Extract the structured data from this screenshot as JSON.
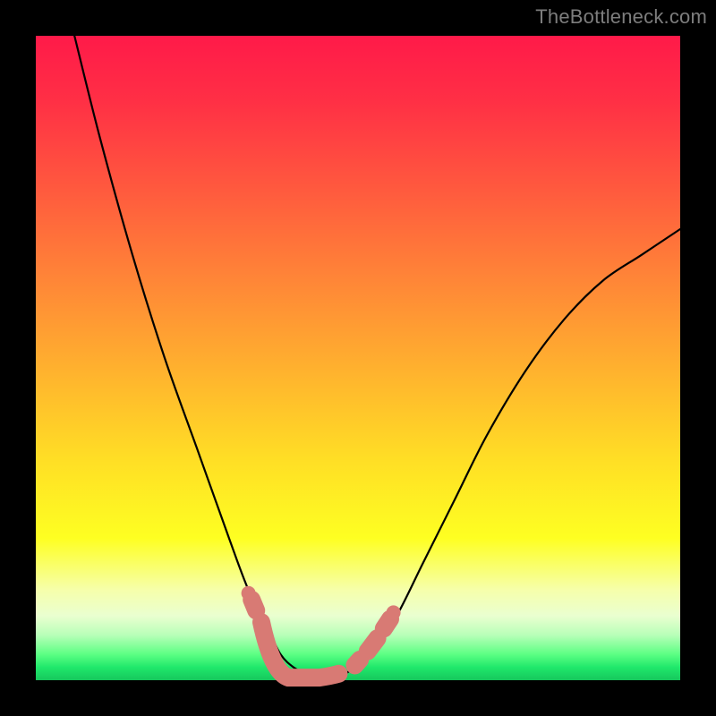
{
  "watermark": "TheBottleneck.com",
  "chart_data": {
    "type": "line",
    "title": "",
    "xlabel": "",
    "ylabel": "",
    "xlim": [
      0,
      100
    ],
    "ylim": [
      0,
      100
    ],
    "grid": false,
    "legend": false,
    "background_gradient": {
      "top": "#ff1a49",
      "mid_upper": "#ff8637",
      "mid": "#ffdf25",
      "mid_lower": "#f6ffab",
      "bottom": "#16c75c"
    },
    "series": [
      {
        "name": "bottleneck-curve",
        "x": [
          6,
          10,
          15,
          20,
          25,
          30,
          33,
          36,
          38,
          40,
          42,
          44,
          46,
          48,
          52,
          56,
          60,
          65,
          70,
          76,
          82,
          88,
          94,
          100
        ],
        "y": [
          100,
          84,
          66,
          50,
          36,
          22,
          14,
          8,
          4,
          2,
          1,
          0.5,
          0.5,
          1,
          4,
          10,
          18,
          28,
          38,
          48,
          56,
          62,
          66,
          70
        ]
      }
    ],
    "markers": {
      "name": "highlighted-range",
      "color": "#d87a74",
      "segments": [
        {
          "x": [
            33.5,
            34.2
          ],
          "y": [
            12.5,
            10.8
          ]
        },
        {
          "x": [
            35.0,
            47.0
          ],
          "y": [
            9.0,
            1.0
          ],
          "flat_bottom": true
        },
        {
          "x": [
            49.5,
            50.3
          ],
          "y": [
            2.3,
            3.2
          ]
        },
        {
          "x": [
            51.5,
            53.0
          ],
          "y": [
            4.5,
            6.5
          ]
        },
        {
          "x": [
            54.0,
            55.0
          ],
          "y": [
            8.0,
            9.5
          ]
        }
      ]
    }
  }
}
